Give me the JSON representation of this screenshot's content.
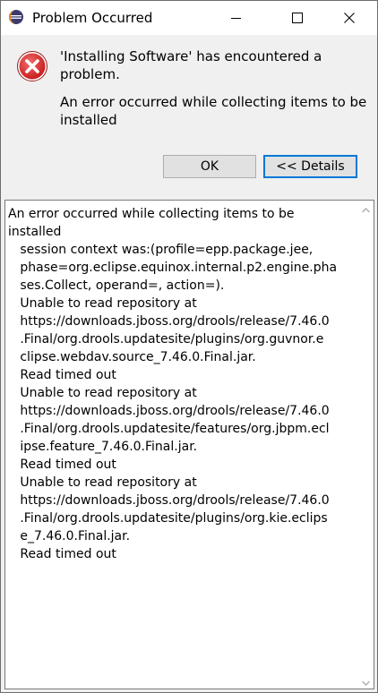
{
  "window": {
    "title": "Problem Occurred",
    "icons": {
      "app": "eclipse-icon",
      "minimize": "minimize-icon",
      "maximize": "maximize-icon",
      "close": "close-icon"
    }
  },
  "message": {
    "icon": "error-icon",
    "title": "'Installing Software' has encountered a problem.",
    "detail": "An error occurred while collecting items to be installed"
  },
  "buttons": {
    "ok_label": "OK",
    "details_label": "<< Details"
  },
  "details": {
    "lines": [
      "An error occurred while collecting items to be",
      "installed",
      "   session context was:(profile=epp.package.jee,",
      "   phase=org.eclipse.equinox.internal.p2.engine.pha",
      "   ses.Collect, operand=, action=).",
      "   Unable to read repository at",
      "   https://downloads.jboss.org/drools/release/7.46.0",
      "   .Final/org.drools.updatesite/plugins/org.guvnor.e",
      "   clipse.webdav.source_7.46.0.Final.jar.",
      "   Read timed out",
      "   Unable to read repository at",
      "   https://downloads.jboss.org/drools/release/7.46.0",
      "   .Final/org.drools.updatesite/features/org.jbpm.ecl",
      "   ipse.feature_7.46.0.Final.jar.",
      "   Read timed out",
      "   Unable to read repository at",
      "   https://downloads.jboss.org/drools/release/7.46.0",
      "   .Final/org.drools.updatesite/plugins/org.kie.eclips",
      "   e_7.46.0.Final.jar.",
      "   Read timed out"
    ]
  },
  "colors": {
    "focus_border": "#0078d7",
    "error_red": "#d32f2f",
    "window_bg": "#f0f0f0"
  }
}
